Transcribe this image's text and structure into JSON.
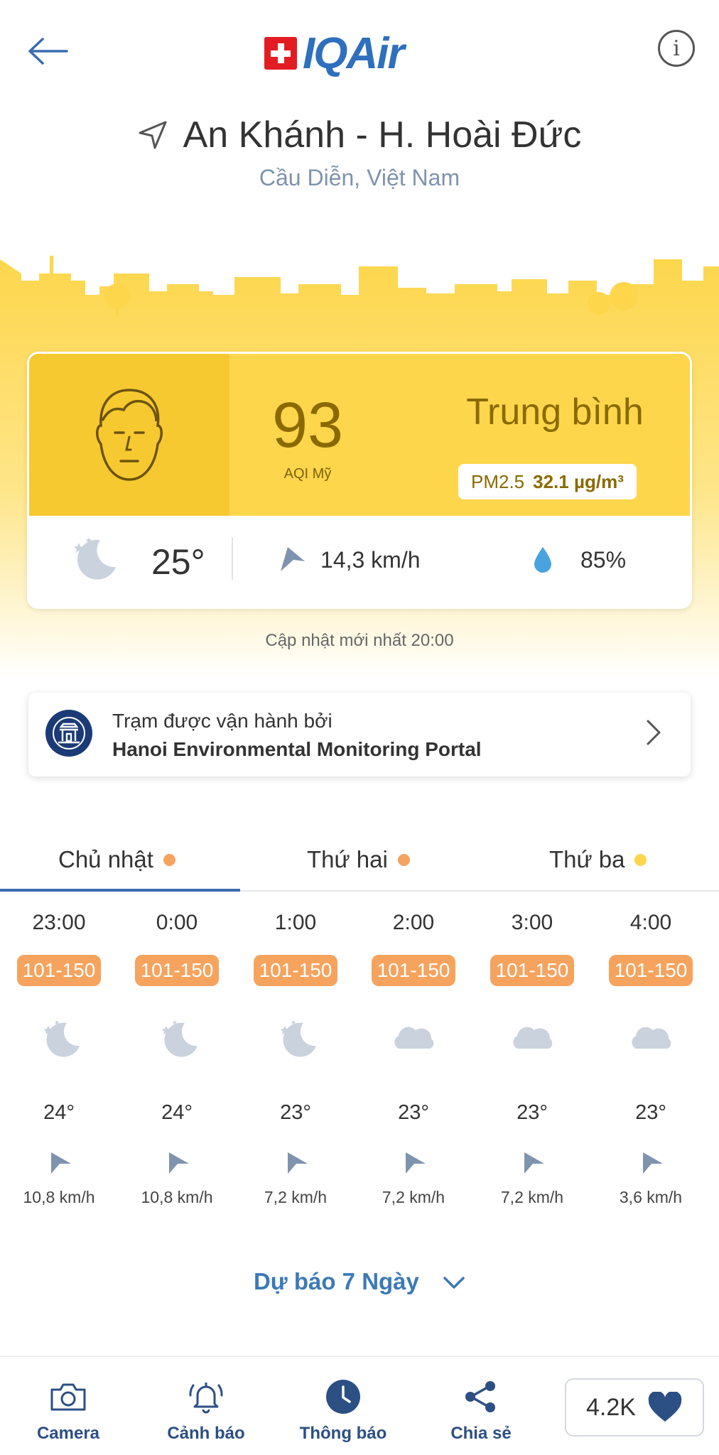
{
  "header": {
    "logo_text": "IQAir",
    "back_icon": "arrow-left-icon",
    "info_icon": "info-icon"
  },
  "location": {
    "title": "An Khánh - H. Hoài Đức",
    "subtitle": "Cầu Diễn, Việt Nam"
  },
  "aqi": {
    "value": "93",
    "label": "AQI Mỹ",
    "status": "Trung bình",
    "pollutant": "PM2.5",
    "pollutant_value": "32.1 µg/m³",
    "color": "#fdd64b"
  },
  "weather": {
    "temperature": "25°",
    "wind": "14,3 km/h",
    "humidity": "85%"
  },
  "updated": "Cập nhật mới nhất 20:00",
  "station": {
    "operated_by": "Trạm được vận hành bởi",
    "name": "Hanoi Environmental Monitoring Portal"
  },
  "tabs": [
    {
      "label": "Chủ nhật",
      "dot_color": "#f6a35e",
      "active": true
    },
    {
      "label": "Thứ hai",
      "dot_color": "#f6a35e",
      "active": false
    },
    {
      "label": "Thứ ba",
      "dot_color": "#fdd64b",
      "active": false
    }
  ],
  "forecast": [
    {
      "time": "23:00",
      "aqi": "101-150",
      "icon": "moon-icon",
      "temp": "24°",
      "wind": "10,8 km/h"
    },
    {
      "time": "0:00",
      "aqi": "101-150",
      "icon": "moon-icon",
      "temp": "24°",
      "wind": "10,8 km/h"
    },
    {
      "time": "1:00",
      "aqi": "101-150",
      "icon": "moon-icon",
      "temp": "23°",
      "wind": "7,2 km/h"
    },
    {
      "time": "2:00",
      "aqi": "101-150",
      "icon": "cloud-icon",
      "temp": "23°",
      "wind": "7,2 km/h"
    },
    {
      "time": "3:00",
      "aqi": "101-150",
      "icon": "cloud-icon",
      "temp": "23°",
      "wind": "7,2 km/h"
    },
    {
      "time": "4:00",
      "aqi": "101-150",
      "icon": "cloud-icon",
      "temp": "23°",
      "wind": "3,6 km/h"
    }
  ],
  "seven_day": "Dự báo 7 Ngày",
  "bottom_nav": [
    {
      "label": "Camera",
      "icon": "camera-icon"
    },
    {
      "label": "Cảnh báo",
      "icon": "bell-icon"
    },
    {
      "label": "Thông báo",
      "icon": "clock-icon"
    },
    {
      "label": "Chia sẻ",
      "icon": "share-icon"
    }
  ],
  "likes": "4.2K"
}
